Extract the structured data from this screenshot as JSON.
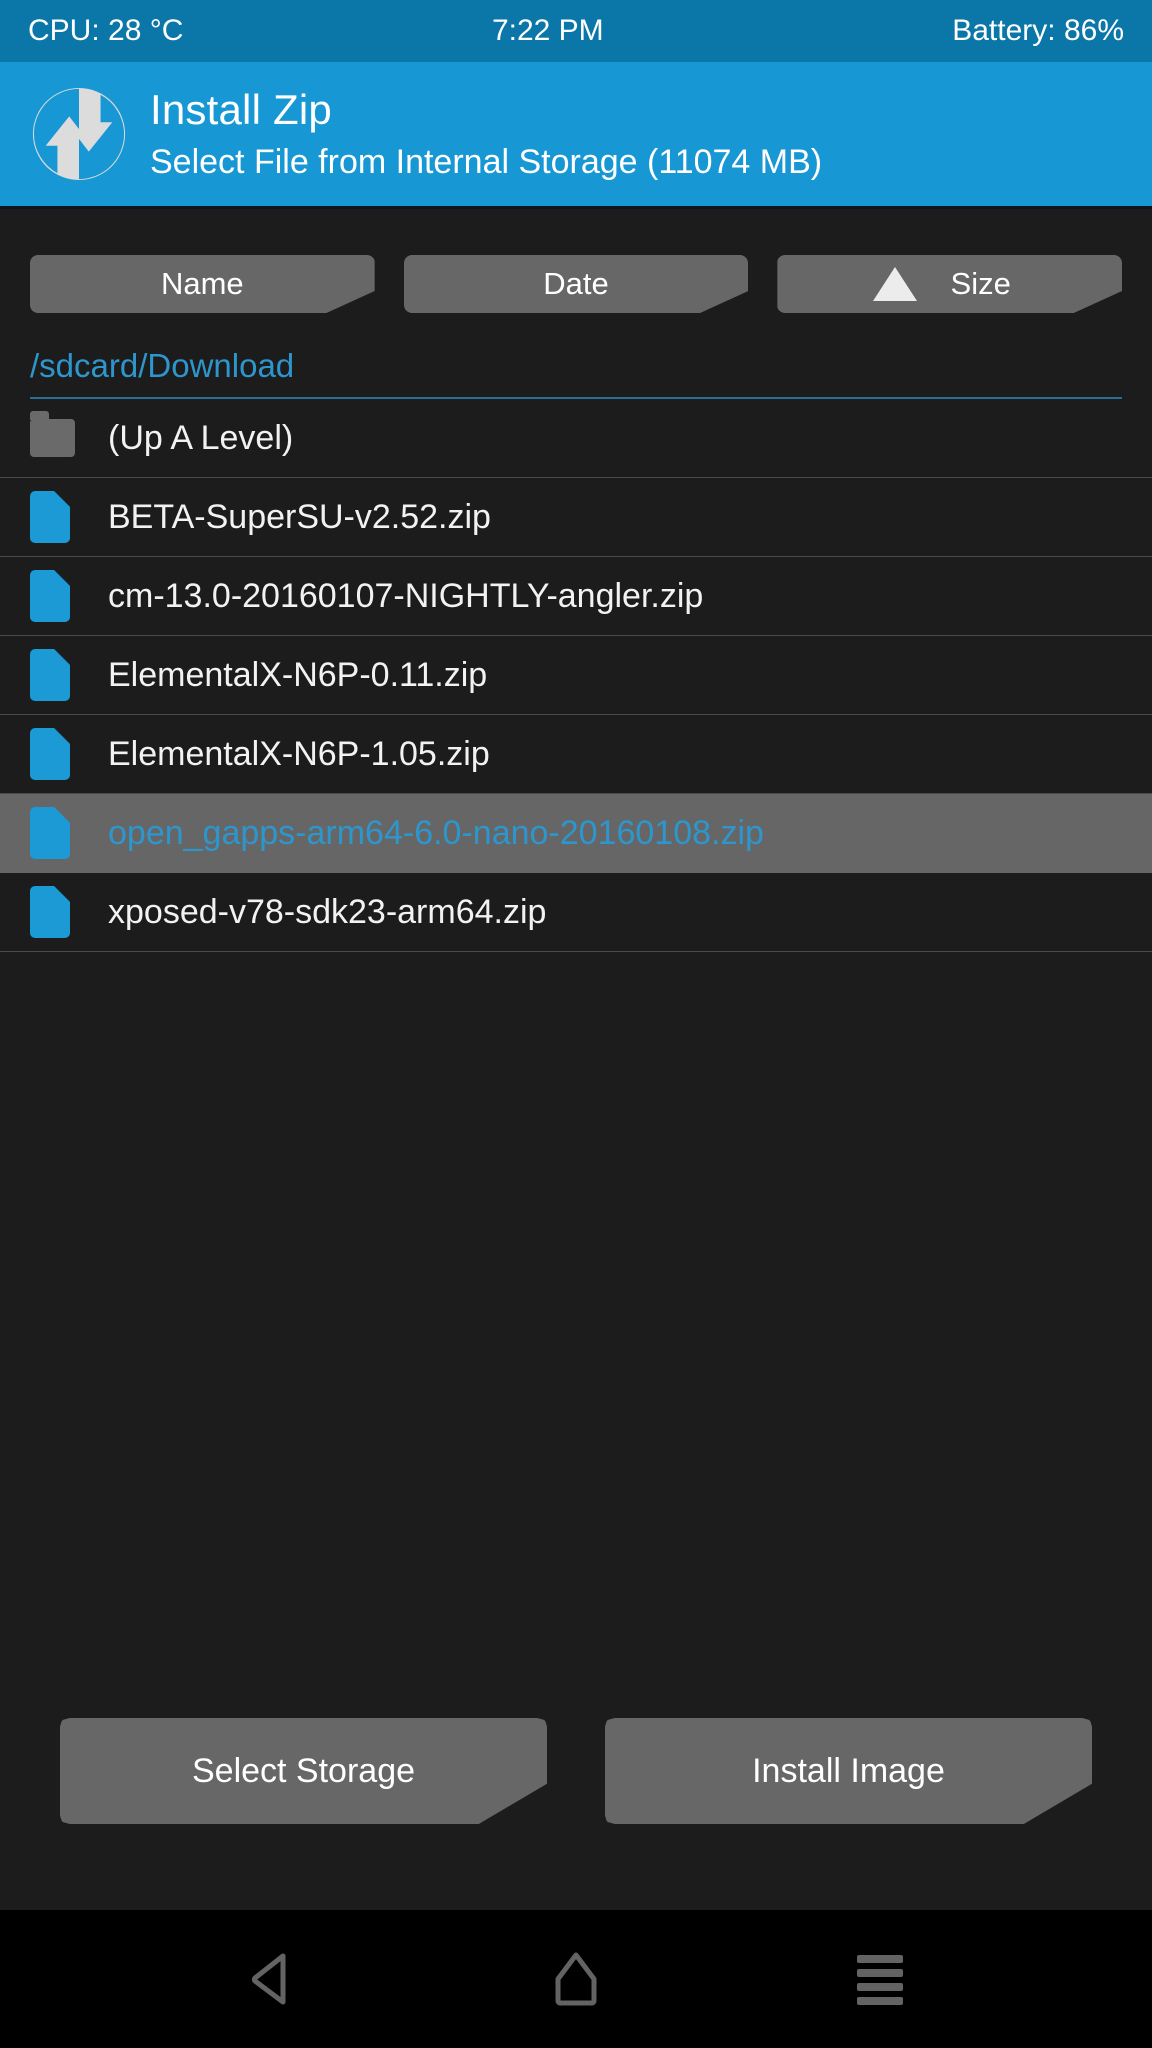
{
  "statusbar": {
    "cpu": "CPU: 28 °C",
    "time": "7:22 PM",
    "battery": "Battery: 86%"
  },
  "header": {
    "logo_icon": "twrp-logo-icon",
    "title": "Install Zip",
    "subtitle": "Select File from Internal Storage (11074 MB)"
  },
  "sort": {
    "name_label": "Name",
    "date_label": "Date",
    "size_label": "Size",
    "active_sort_icon": "sort-ascending-triangle-icon"
  },
  "path": "/sdcard/Download",
  "files": [
    {
      "name": "(Up A Level)",
      "icon": "folder-icon",
      "selected": false
    },
    {
      "name": "BETA-SuperSU-v2.52.zip",
      "icon": "file-icon",
      "selected": false
    },
    {
      "name": "cm-13.0-20160107-NIGHTLY-angler.zip",
      "icon": "file-icon",
      "selected": false
    },
    {
      "name": "ElementalX-N6P-0.11.zip",
      "icon": "file-icon",
      "selected": false
    },
    {
      "name": "ElementalX-N6P-1.05.zip",
      "icon": "file-icon",
      "selected": false
    },
    {
      "name": "open_gapps-arm64-6.0-nano-20160108.zip",
      "icon": "file-icon",
      "selected": true
    },
    {
      "name": "xposed-v78-sdk23-arm64.zip",
      "icon": "file-icon",
      "selected": false
    }
  ],
  "actions": {
    "select_storage_label": "Select Storage",
    "install_image_label": "Install Image"
  },
  "navbar": {
    "back_icon": "back-triangle-icon",
    "home_icon": "home-icon",
    "recents_icon": "menu-lines-icon"
  },
  "colors": {
    "accent": "#1797d4",
    "statusbar": "#0b76a8",
    "background": "#1c1c1c",
    "button": "#676767",
    "selected_row": "#666666",
    "link": "#2d96cd",
    "file_icon": "#1b9ad6"
  }
}
